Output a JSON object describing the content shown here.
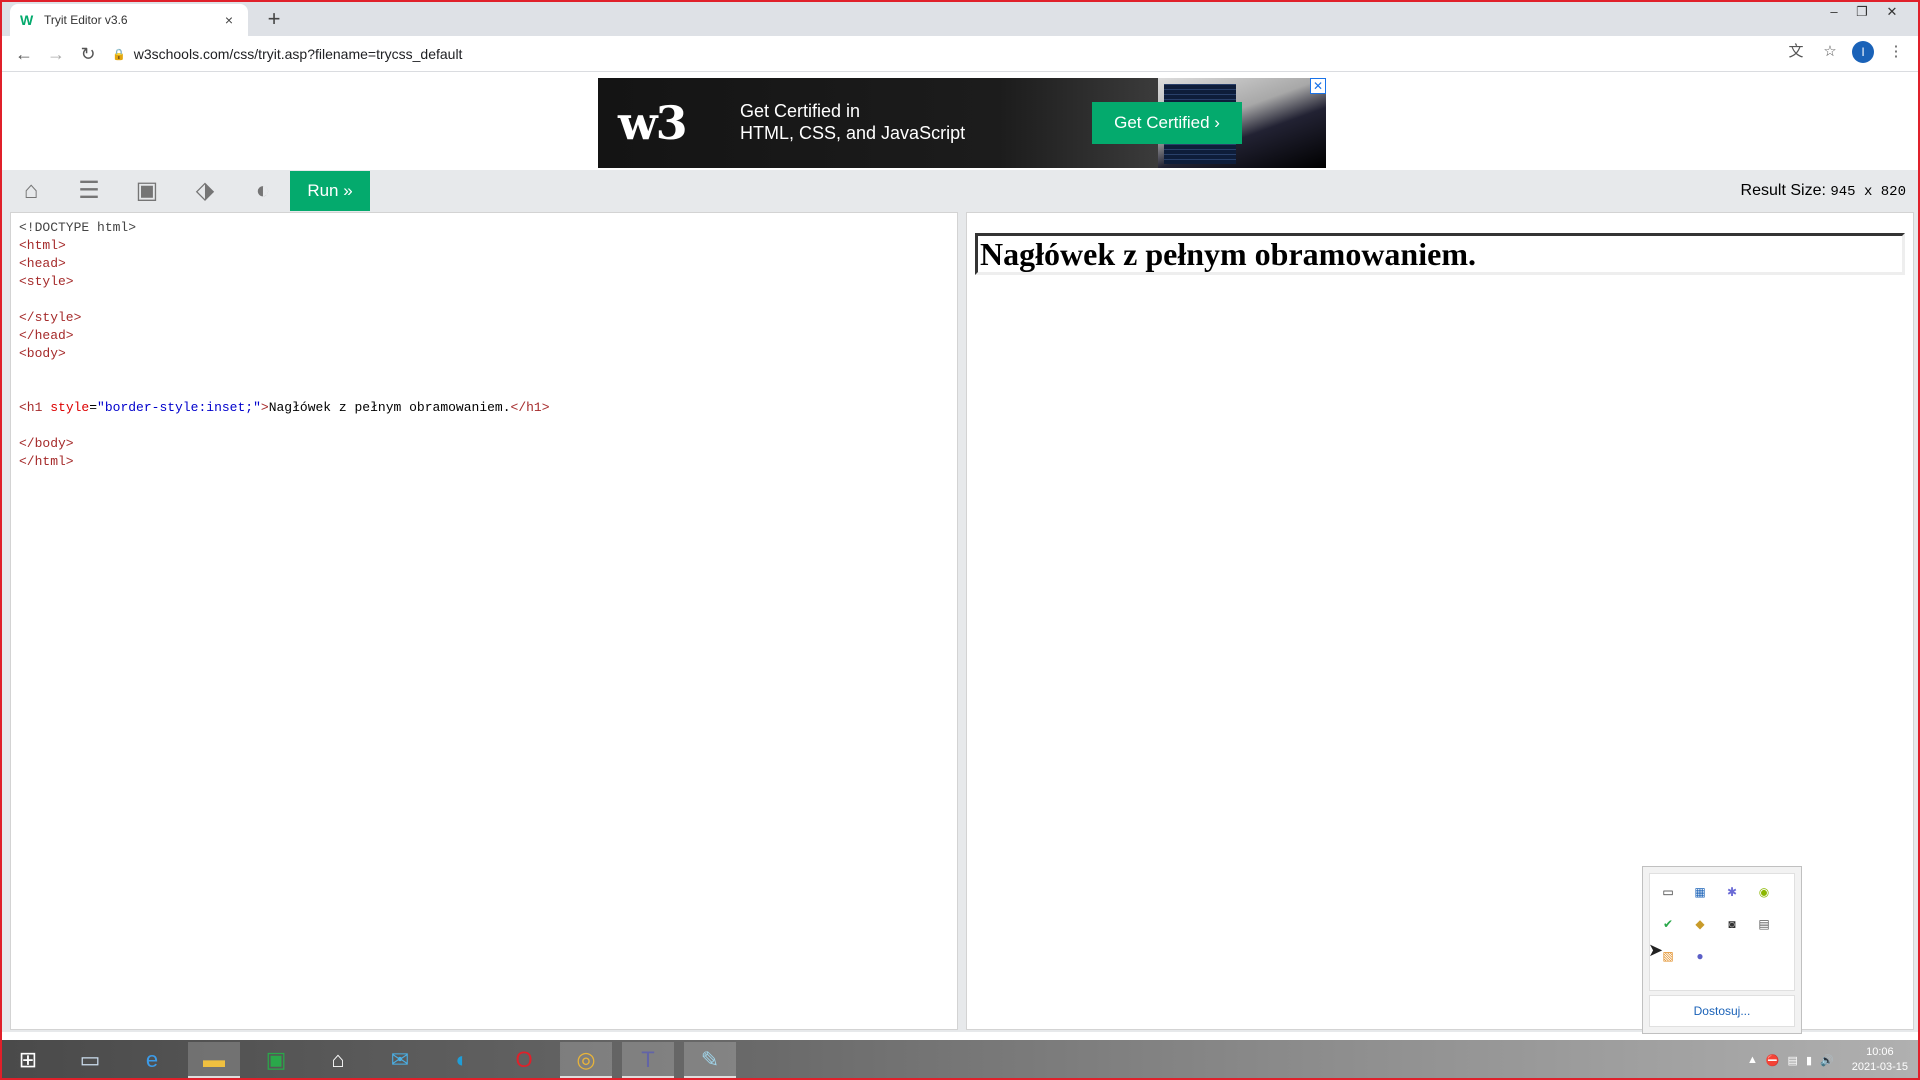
{
  "browser": {
    "tab_title": "Tryit Editor v3.6",
    "tab_close": "×",
    "new_tab": "+",
    "url": "w3schools.com/css/tryit.asp?filename=trycss_default",
    "profile_initial": "I",
    "window_controls": {
      "minimize": "–",
      "restore": "❐",
      "close": "✕"
    }
  },
  "ad": {
    "logo": "w3",
    "line1": "Get Certified in",
    "line2": "HTML, CSS, and JavaScript",
    "cta": "Get Certified ›",
    "close": "✕"
  },
  "toolbar": {
    "run_label": "Run »",
    "result_size_label": "Result Size:",
    "result_size_value": "945 x 820"
  },
  "code": {
    "lines": [
      "<!DOCTYPE html>",
      "<html>",
      "<head>",
      "<style>",
      "",
      "</style>",
      "</head>",
      "<body>",
      "",
      "",
      "<h1 style=\"border-style:inset;\">Nagłówek z pełnym obramowaniem.</h1>",
      "",
      "</body>",
      "</html>"
    ]
  },
  "result": {
    "heading": "Nagłówek z pełnym obramowaniem."
  },
  "tray_popup": {
    "customize_label": "Dostosuj...",
    "icons": [
      "display-icon",
      "network-app-icon",
      "bluetooth-icon",
      "update-icon",
      "shield-check-icon",
      "package-icon",
      "camera-icon",
      "printer-icon",
      "sticky-icon",
      "teams-icon"
    ]
  },
  "taskbar": {
    "apps": [
      "start-icon",
      "lenovo-icon",
      "ie-icon",
      "explorer-icon",
      "store-icon",
      "home-icon",
      "mail-icon",
      "edge-icon",
      "opera-icon",
      "chrome-icon",
      "teams-icon",
      "pen-icon"
    ],
    "time": "10:06",
    "date": "2021-03-15"
  },
  "colors": {
    "accent_green": "#04aa6d",
    "frame_red": "#e0202a"
  }
}
